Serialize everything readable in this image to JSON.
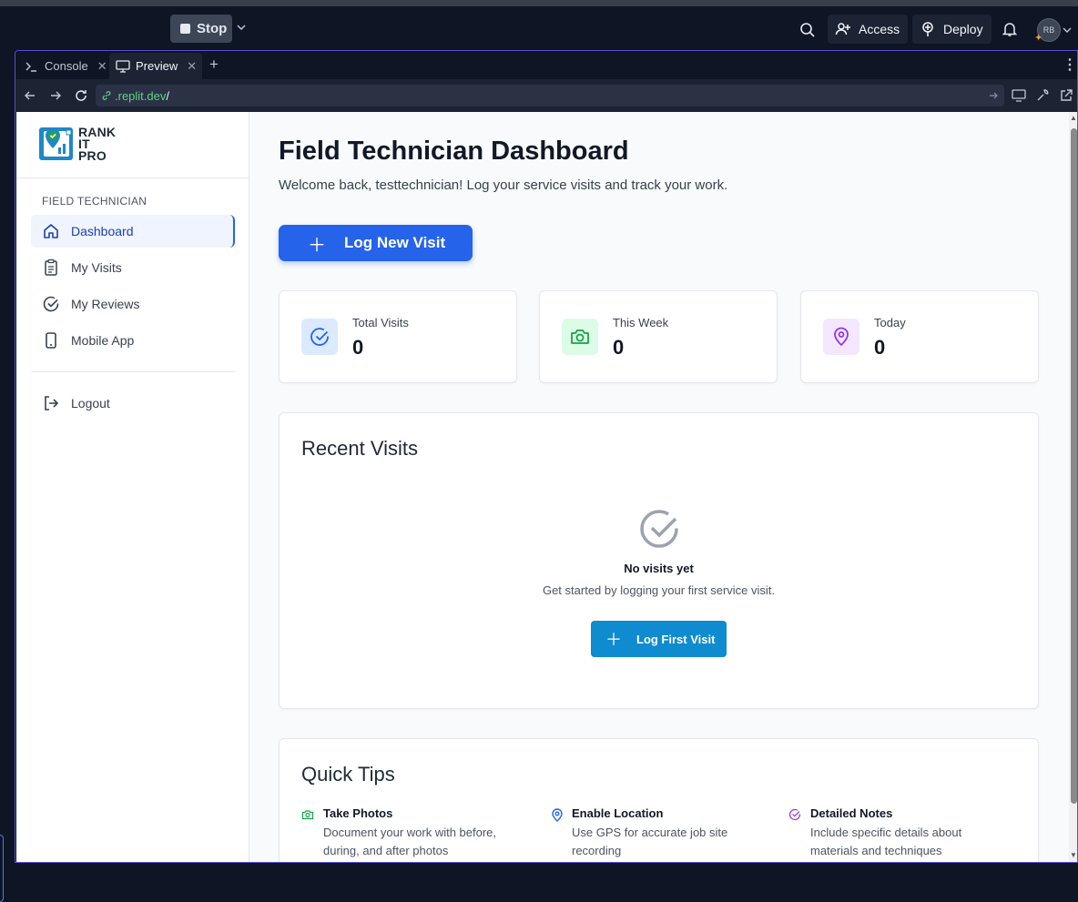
{
  "ide": {
    "stop_label": "Stop",
    "access_label": "Access",
    "deploy_label": "Deploy",
    "avatar_initials": "RB",
    "tabs": [
      {
        "label": "Console"
      },
      {
        "label": "Preview"
      }
    ],
    "url_host": ".replit.dev",
    "url_path": "/"
  },
  "sidebar": {
    "logo_lines": [
      "RANK",
      "IT",
      "PRO"
    ],
    "section_label": "FIELD TECHNICIAN",
    "items": [
      {
        "label": "Dashboard",
        "icon": "home-icon",
        "active": true
      },
      {
        "label": "My Visits",
        "icon": "clipboard-icon"
      },
      {
        "label": "My Reviews",
        "icon": "check-circle-icon"
      },
      {
        "label": "Mobile App",
        "icon": "smartphone-icon"
      }
    ],
    "logout_label": "Logout"
  },
  "main": {
    "title": "Field Technician Dashboard",
    "subtitle": "Welcome back, testtechnician! Log your service visits and track your work.",
    "log_new_visit": "Log New Visit",
    "stats": [
      {
        "label": "Total Visits",
        "value": "0",
        "icon": "check-circle-icon",
        "bg": "#dbeafe",
        "color": "#2563eb"
      },
      {
        "label": "This Week",
        "value": "0",
        "icon": "camera-icon",
        "bg": "#dcfce7",
        "color": "#16a34a"
      },
      {
        "label": "Today",
        "value": "0",
        "icon": "map-pin-icon",
        "bg": "#f3e8ff",
        "color": "#9333ea"
      }
    ],
    "recent": {
      "title": "Recent Visits",
      "empty_title": "No visits yet",
      "empty_sub": "Get started by logging your first service visit.",
      "button": "Log First Visit"
    },
    "tips": {
      "title": "Quick Tips",
      "items": [
        {
          "title": "Take Photos",
          "desc": "Document your work with before, during, and after photos",
          "icon": "camera-icon",
          "color": "#16a34a"
        },
        {
          "title": "Enable Location",
          "desc": "Use GPS for accurate job site recording",
          "icon": "map-pin-icon",
          "color": "#2563eb"
        },
        {
          "title": "Detailed Notes",
          "desc": "Include specific details about materials and techniques",
          "icon": "check-circle-icon",
          "color": "#9333ea"
        }
      ]
    }
  },
  "colors": {
    "primary": "#2563eb",
    "secondary_button": "#0f8bcf",
    "ide_bg": "#0e1525"
  }
}
